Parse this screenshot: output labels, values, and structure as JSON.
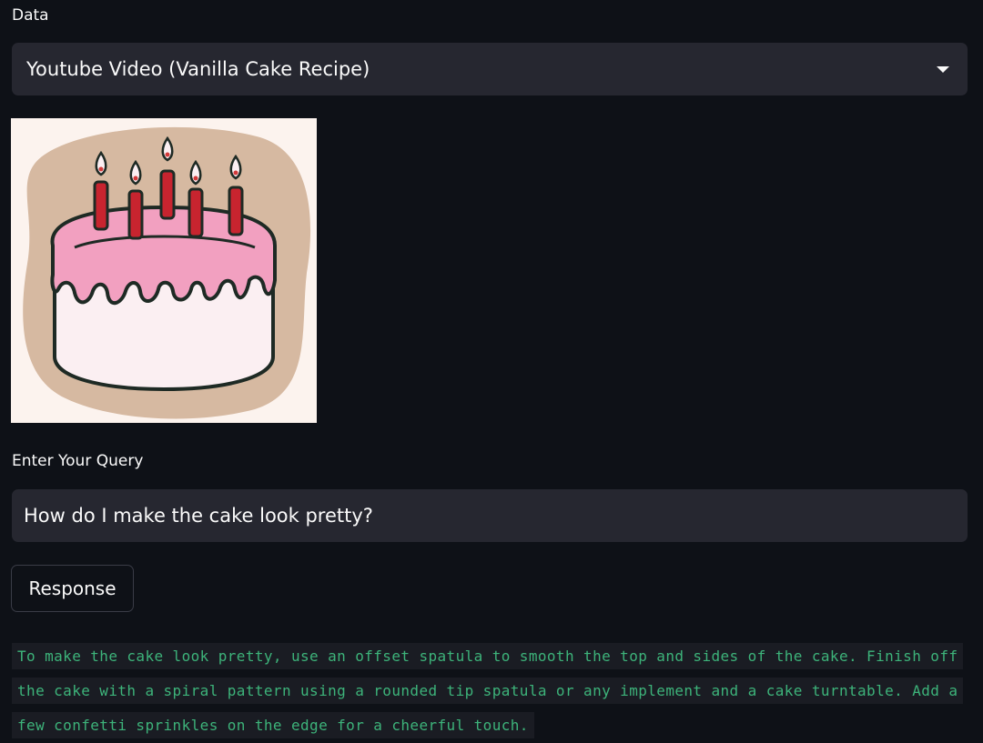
{
  "data_label": "Data",
  "select": {
    "value": "Youtube Video (Vanilla Cake Recipe)",
    "icon": "chevron-down-icon"
  },
  "image": {
    "icon": "birthday-cake-image"
  },
  "query_label": "Enter Your Query",
  "query_input": {
    "value": "How do I make the cake look pretty?"
  },
  "response_button": "Response",
  "response_text": "To make the cake look pretty, use an offset spatula to smooth the top and sides of the cake. Finish off the cake with a spiral pattern using a rounded tip spatula or any implement and a cake turntable. Add a few confetti sprinkles on the edge for a cheerful touch.",
  "colors": {
    "background": "#0e1117",
    "input_bg": "#262730",
    "response_text": "#3db37a"
  }
}
